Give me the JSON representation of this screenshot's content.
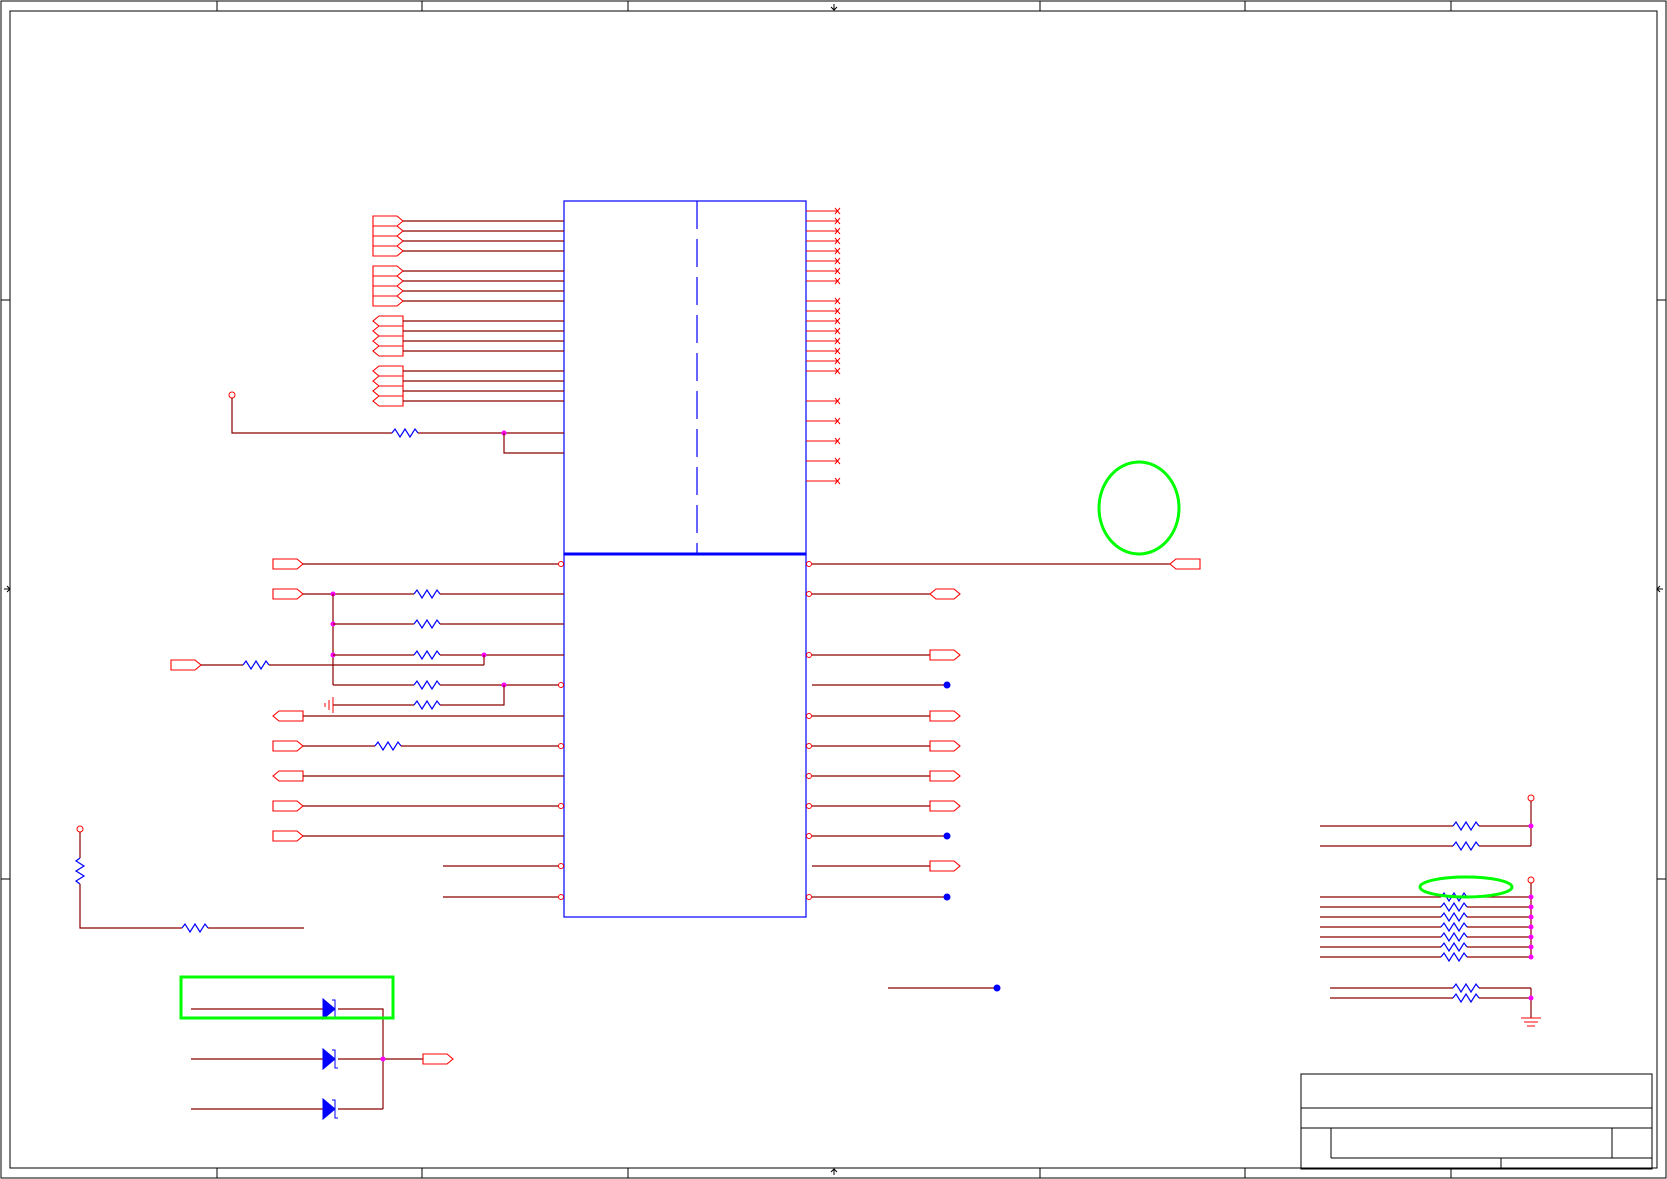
{
  "sheet": {
    "border_color": "#000000",
    "wire_color": "#8b0000",
    "pin_color": "#ff0000",
    "component_color": "#0000ff",
    "junction_color": "#ff00ff",
    "highlight_color": "#00ff00"
  },
  "components": {
    "ic_upper": "integrated-circuit-upper-section",
    "ic_lower": "integrated-circuit-lower-section",
    "resistor_icon": "resistor-icon",
    "diode_icon": "tvs-diode-icon",
    "ground_icon": "ground-icon",
    "port_icon": "net-port-icon"
  },
  "annotations": {
    "highlight_circle": "green-circle-annotation",
    "highlight_ellipse": "green-ellipse-annotation",
    "highlight_rect": "green-rectangle-annotation"
  },
  "title_block": {
    "title": "",
    "size": "",
    "sheet": ""
  }
}
